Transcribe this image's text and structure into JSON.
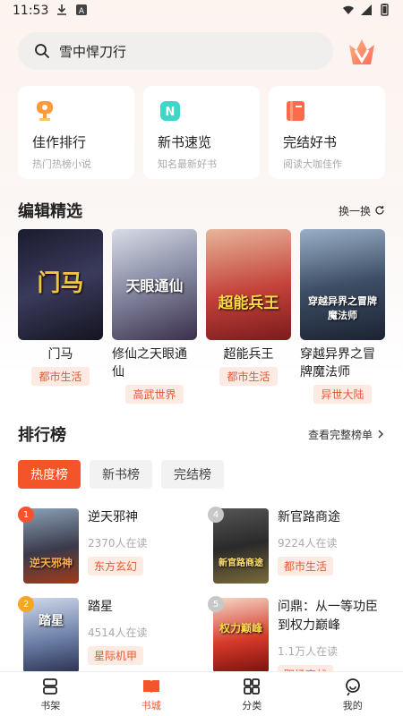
{
  "status_bar": {
    "time": "11:53"
  },
  "search": {
    "text": "雪中悍刀行"
  },
  "quick_entries": [
    {
      "title": "佳作排行",
      "subtitle": "热门热榜小说",
      "icon": "trophy-icon"
    },
    {
      "title": "新书速览",
      "subtitle": "知名最新好书",
      "icon": "new-book-icon"
    },
    {
      "title": "完结好书",
      "subtitle": "阅读大咖佳作",
      "icon": "finished-book-icon"
    }
  ],
  "editor_picks": {
    "title": "编辑精选",
    "action": "换一换",
    "books": [
      {
        "name": "门马",
        "tag": "都市生活",
        "cover_text": "门马"
      },
      {
        "name": "修仙之天眼通仙",
        "tag": "高武世界",
        "cover_text": "天眼通仙"
      },
      {
        "name": "超能兵王",
        "tag": "都市生活",
        "cover_text": "超能兵王"
      },
      {
        "name": "穿越异界之冒牌魔法师",
        "tag": "异世大陆",
        "cover_text": "穿越异界之冒牌魔法师"
      }
    ]
  },
  "ranking": {
    "title": "排行榜",
    "action": "查看完整榜单",
    "tabs": [
      "热度榜",
      "新书榜",
      "完结榜"
    ],
    "items": [
      {
        "rank": "1",
        "title": "逆天邪神",
        "readers": "2370人在读",
        "tag": "东方玄幻",
        "cover_text": "逆天邪神"
      },
      {
        "rank": "4",
        "title": "新官路商途",
        "readers": "9224人在读",
        "tag": "都市生活",
        "cover_text": "新官路商途"
      },
      {
        "rank": "2",
        "title": "踏星",
        "readers": "4514人在读",
        "tag": "星际机甲",
        "cover_text": "踏星"
      },
      {
        "rank": "5",
        "title": "问鼎：从一等功臣到权力巅峰",
        "readers": "1.1万人在读",
        "tag": "职场商战",
        "cover_text": "权力巅峰"
      }
    ]
  },
  "tab_bar": [
    "书架",
    "书城",
    "分类",
    "我的"
  ],
  "colors": {
    "accent": "#f4542a",
    "tag_text": "#e65a32",
    "tag_bg": "#fdeae3"
  }
}
